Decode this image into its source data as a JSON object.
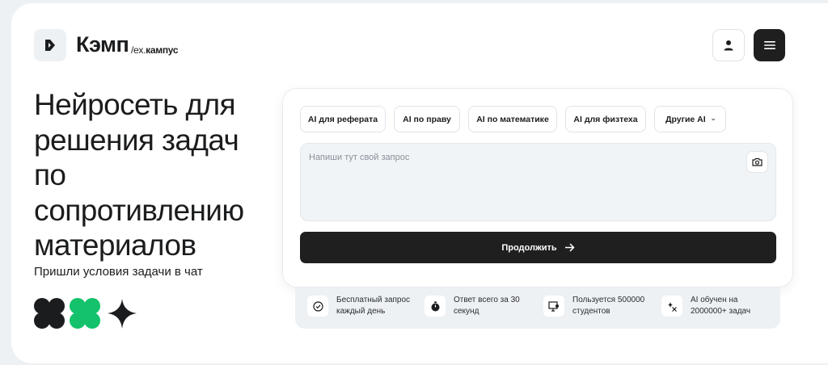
{
  "header": {
    "brand": "Кэмп",
    "brand_sub_prefix": "/ex.",
    "brand_sub_name": "кампус",
    "logo_icon": "k-logo-icon",
    "user_icon": "user-icon",
    "menu_icon": "hamburger-menu-icon"
  },
  "hero": {
    "title": "Нейросеть для решения задач по сопротивлению материалов",
    "subtitle": "Пришли условия задачи в чат"
  },
  "chips": [
    {
      "label": "AI для реферата"
    },
    {
      "label": "AI по праву"
    },
    {
      "label": "AI по математике"
    },
    {
      "label": "AI для физтеха"
    },
    {
      "label": "Другие AI"
    }
  ],
  "query": {
    "placeholder": "Напиши тут свой запрос",
    "value": ""
  },
  "submit": {
    "label": "Продолжить"
  },
  "features": [
    {
      "icon": "check-badge-icon",
      "text": "Бесплатный запрос каждый день"
    },
    {
      "icon": "stopwatch-icon",
      "text": "Ответ всего за 30 секунд"
    },
    {
      "icon": "monitor-user-icon",
      "text": "Пользуется 500000 студентов"
    },
    {
      "icon": "sparkle-icon",
      "text": "AI обучен на 2000000+ задач"
    }
  ],
  "colors": {
    "dark": "#1f1f1f",
    "accent_green": "#13c26a",
    "background": "#eef1f4"
  }
}
